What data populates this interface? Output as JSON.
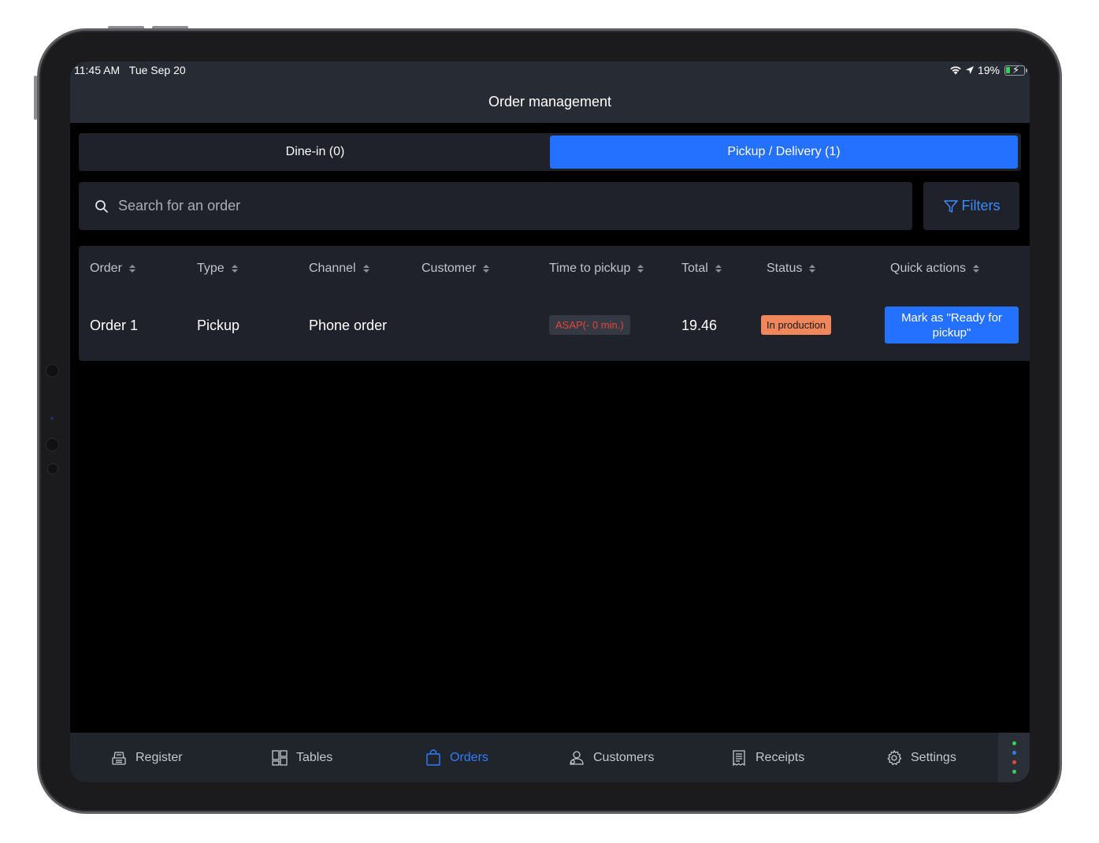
{
  "status_bar": {
    "time": "11:45 AM",
    "date": "Tue Sep 20",
    "battery": "19%"
  },
  "header": {
    "title": "Order management"
  },
  "tabs": [
    {
      "label": "Dine-in (0)",
      "active": false
    },
    {
      "label": "Pickup / Delivery (1)",
      "active": true
    }
  ],
  "search": {
    "placeholder": "Search for an order",
    "value": ""
  },
  "filters": {
    "label": "Filters"
  },
  "table": {
    "columns": [
      "Order",
      "Type",
      "Channel",
      "Customer",
      "Time to pickup",
      "Total",
      "Status",
      "Quick actions"
    ],
    "rows": [
      {
        "order": "Order 1",
        "type": "Pickup",
        "channel": "Phone order",
        "customer": "",
        "time_to_pickup": "ASAP(- 0 min.)",
        "total": "19.46",
        "status": "In production",
        "quick_action": "Mark as \"Ready for pickup\""
      }
    ]
  },
  "tabbar": [
    {
      "label": "Register",
      "icon": "register-icon",
      "active": false
    },
    {
      "label": "Tables",
      "icon": "tables-icon",
      "active": false
    },
    {
      "label": "Orders",
      "icon": "shopping-bag-icon",
      "active": true
    },
    {
      "label": "Customers",
      "icon": "customers-icon",
      "active": false
    },
    {
      "label": "Receipts",
      "icon": "receipt-icon",
      "active": false
    },
    {
      "label": "Settings",
      "icon": "gear-icon",
      "active": false
    }
  ],
  "colors": {
    "accent": "#2470ff",
    "status_in_production": "#f0865b",
    "asap_text": "#e3473c",
    "dot_colors": [
      "#37d058",
      "#2f7cff",
      "#e3473c",
      "#37d058"
    ]
  }
}
